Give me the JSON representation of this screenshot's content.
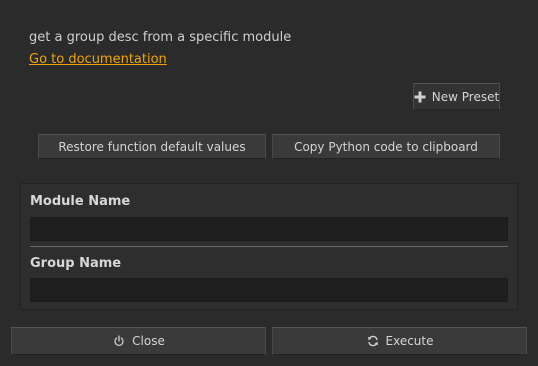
{
  "description": "get a group desc from a specific module",
  "doc_link": "Go to documentation",
  "preset": {
    "label": "New Preset",
    "icon": "plus-icon"
  },
  "actions": {
    "restore_label": "Restore function default values",
    "copy_label": "Copy Python code to clipboard"
  },
  "params": [
    {
      "label": "Module Name",
      "value": ""
    },
    {
      "label": "Group Name",
      "value": ""
    }
  ],
  "footer": {
    "close_label": "Close",
    "close_icon": "power-icon",
    "execute_label": "Execute",
    "execute_icon": "refresh-icon"
  },
  "colors": {
    "background": "#2b2b2b",
    "link": "#f0a30a",
    "button": "#3a3a3a",
    "input": "#1f1f1f"
  }
}
